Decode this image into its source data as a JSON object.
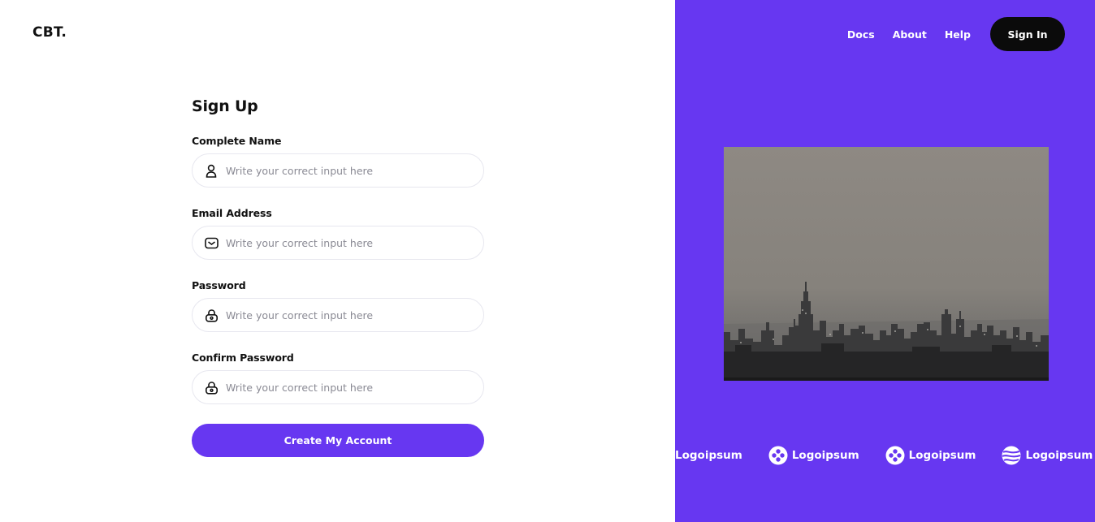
{
  "brand": "CBT.",
  "nav": {
    "links": [
      "Docs",
      "About",
      "Help"
    ],
    "signin_label": "Sign In"
  },
  "form": {
    "title": "Sign Up",
    "fields": [
      {
        "label": "Complete Name",
        "placeholder": "Write your correct input here",
        "icon": "user-icon"
      },
      {
        "label": "Email Address",
        "placeholder": "Write your correct input here",
        "icon": "mail-icon"
      },
      {
        "label": "Password",
        "placeholder": "Write your correct input here",
        "icon": "lock-icon"
      },
      {
        "label": "Confirm Password",
        "placeholder": "Write your correct input here",
        "icon": "lock-icon"
      }
    ],
    "submit_label": "Create My Account"
  },
  "logos": [
    {
      "text": "Logoipsum",
      "icon": "none"
    },
    {
      "text": "Logoipsum",
      "icon": "dots-circle-icon"
    },
    {
      "text": "Logoipsum",
      "icon": "dots-circle-icon"
    },
    {
      "text": "Logoipsum",
      "icon": "stripes-circle-icon"
    }
  ],
  "colors": {
    "accent": "#6737f1",
    "dark_button": "#0b0b0b"
  }
}
